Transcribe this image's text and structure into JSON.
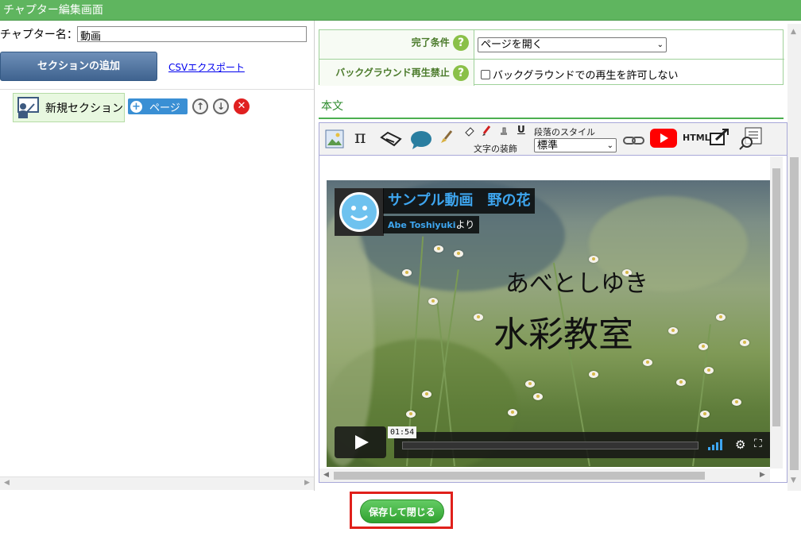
{
  "window": {
    "title": "チャプター編集画面"
  },
  "chapter": {
    "name_label": "チャプター名：",
    "name_value": "動画"
  },
  "left": {
    "add_section_label": "セクションの追加",
    "csv_export_label": "CSVエクスポート",
    "section": {
      "label": "新規セクション",
      "page_button_label": "ページ"
    }
  },
  "form": {
    "completion_label": "完了条件",
    "completion_value": "ページを開く",
    "bg_label": "バックグラウンド再生禁止",
    "bg_checkbox_label": "バックグラウンドでの再生を許可しない"
  },
  "editor": {
    "section_title": "本文",
    "toolbar": {
      "pi_label": "π",
      "underline_label": "U",
      "text_decoration_label": "文字の装飾",
      "paragraph_style_label": "段落のスタイル",
      "paragraph_style_value": "標準",
      "html_label": "HTML"
    },
    "video": {
      "title": "サンプル動画　野の花",
      "channel_name": "Abe Toshiyuki",
      "channel_suffix": "より",
      "overlay_line1": "あべとしゆき",
      "overlay_line2": "水彩教室",
      "time_tooltip": "01:54"
    }
  },
  "footer": {
    "save_close_label": "保存して閉じる"
  },
  "colors": {
    "titlebar": "#5fb55f",
    "accent_green": "#4caf50",
    "page_button": "#3a8fd4",
    "highlight_border": "#e0201b"
  }
}
